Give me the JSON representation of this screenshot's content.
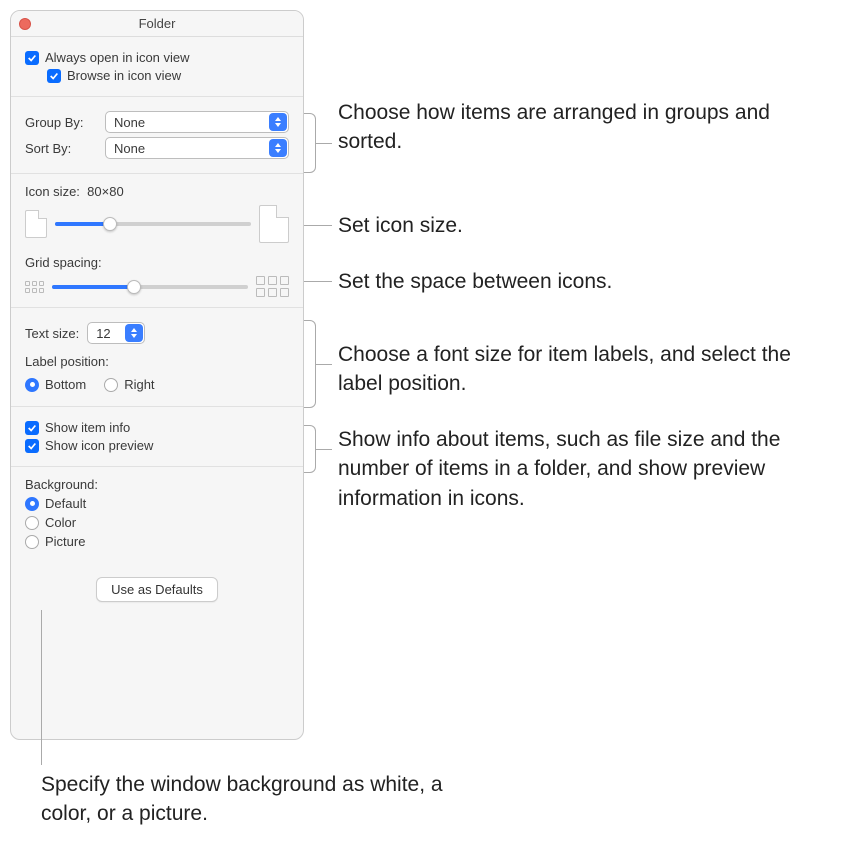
{
  "window": {
    "title": "Folder"
  },
  "view_options": {
    "always_open_icon": "Always open in icon view",
    "browse_icon": "Browse in icon view"
  },
  "grouping": {
    "group_by_label": "Group By:",
    "group_by_value": "None",
    "sort_by_label": "Sort By:",
    "sort_by_value": "None"
  },
  "icon_size": {
    "label": "Icon size:",
    "value": "80×80",
    "slider_pct": 28
  },
  "grid_spacing": {
    "label": "Grid spacing:",
    "slider_pct": 42
  },
  "text": {
    "text_size_label": "Text size:",
    "text_size_value": "12",
    "label_position_label": "Label position:",
    "bottom": "Bottom",
    "right": "Right"
  },
  "info": {
    "show_item_info": "Show item info",
    "show_icon_preview": "Show icon preview"
  },
  "background": {
    "label": "Background:",
    "default": "Default",
    "color": "Color",
    "picture": "Picture"
  },
  "defaults_button": "Use as Defaults",
  "callouts": {
    "grouping": "Choose how items are arranged in groups and sorted.",
    "icon_size": "Set icon size.",
    "grid_spacing": "Set the space between icons.",
    "text": "Choose a font size for item labels, and select the label position.",
    "info": "Show info about items, such as file size and the number of items in a folder, and show preview information in icons.",
    "background": "Specify the window background as white, a color, or a picture."
  }
}
